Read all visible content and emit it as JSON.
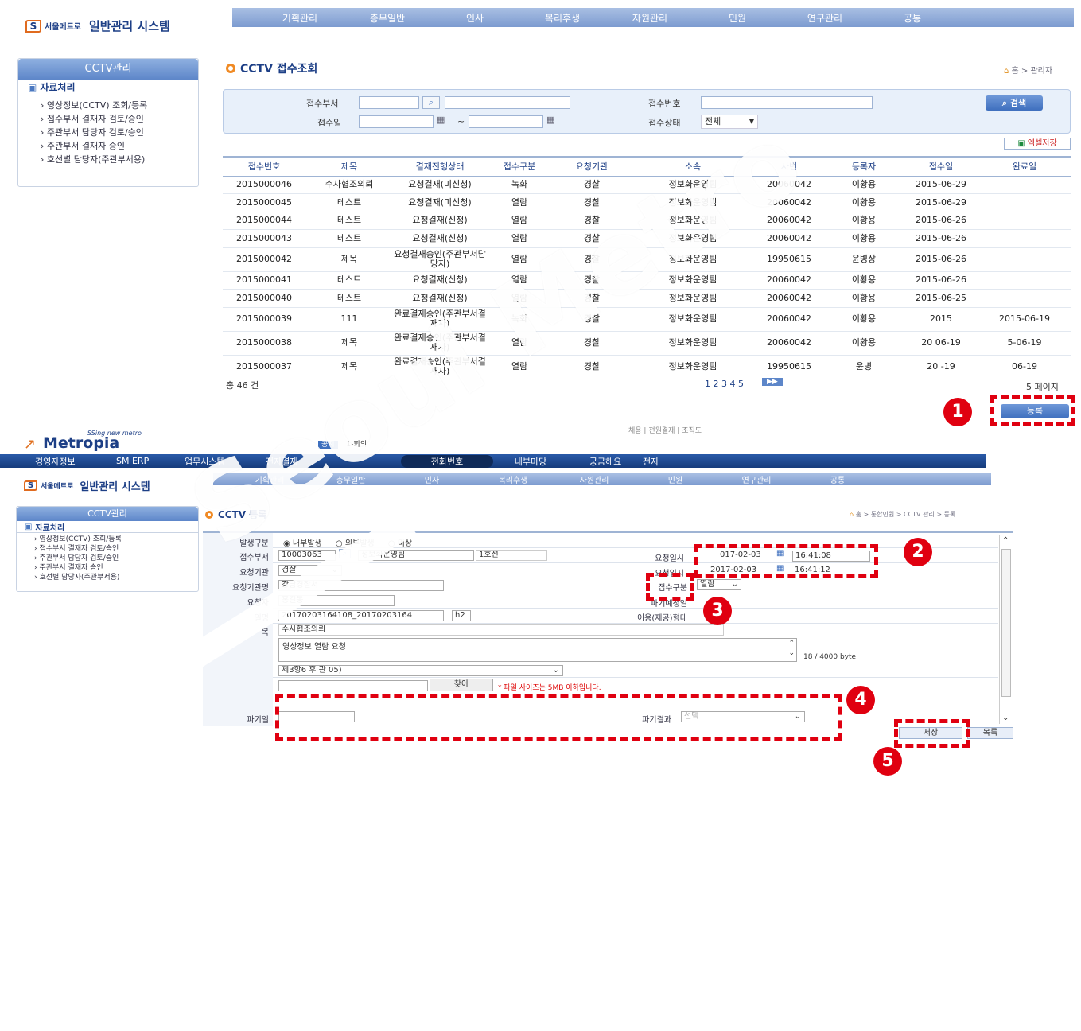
{
  "top": {
    "logo_text": "서울메트로",
    "system_title": "일반관리 시스템",
    "nav": [
      "기획관리",
      "총무일반",
      "인사",
      "복리후생",
      "자원관리",
      "민원",
      "연구관리",
      "공통"
    ]
  },
  "sidebar": {
    "header": "CCTV관리",
    "section": "자료처리",
    "items": [
      "영상정보(CCTV) 조회/등록",
      "접수부서 결재자 검토/승인",
      "주관부서 담당자 검토/승인",
      "주관부서 결재자 승인",
      "호선별 담당자(주관부서용)"
    ]
  },
  "page": {
    "title": "CCTV 접수조회",
    "breadcrumb": "홈 > 관리자"
  },
  "search": {
    "dept_label": "접수부서",
    "date_label": "접수일",
    "tilde": "~",
    "no_label": "접수번호",
    "status_label": "접수상태",
    "status_value": "전체",
    "search_button": "검색",
    "excel_button": "엑셀저장"
  },
  "table": {
    "headers": [
      "접수번호",
      "제목",
      "결재진행상태",
      "접수구분",
      "요청기관",
      "소속",
      "사번",
      "등록자",
      "접수일",
      "완료일"
    ],
    "rows": [
      [
        "2015000046",
        "수사협조의뢰",
        "요청결재(미신청)",
        "녹화",
        "경찰",
        "정보화운영팀",
        "20060042",
        "이황용",
        "2015-06-29",
        ""
      ],
      [
        "2015000045",
        "테스트",
        "요청결재(미신청)",
        "열람",
        "경찰",
        "정보화운영팀",
        "20060042",
        "이황용",
        "2015-06-29",
        ""
      ],
      [
        "2015000044",
        "테스트",
        "요청결재(신청)",
        "열람",
        "경찰",
        "정보화운영팀",
        "20060042",
        "이황용",
        "2015-06-26",
        ""
      ],
      [
        "2015000043",
        "테스트",
        "요청결재(신청)",
        "열람",
        "경찰",
        "정보화운영팀",
        "20060042",
        "이황용",
        "2015-06-26",
        ""
      ],
      [
        "2015000042",
        "제목",
        "요청결재승인(주관부서담당자)",
        "열람",
        "경찰",
        "정보화운영팀",
        "19950615",
        "윤병상",
        "2015-06-26",
        ""
      ],
      [
        "2015000041",
        "테스트",
        "요청결재(신청)",
        "열람",
        "경찰",
        "정보화운영팀",
        "20060042",
        "이황용",
        "2015-06-26",
        ""
      ],
      [
        "2015000040",
        "테스트",
        "요청결재(신청)",
        "열람",
        "경찰",
        "정보화운영팀",
        "20060042",
        "이황용",
        "2015-06-25",
        ""
      ],
      [
        "2015000039",
        "111",
        "완료결재승인(주관부서결재자)",
        "녹화",
        "경찰",
        "정보화운영팀",
        "20060042",
        "이황용",
        "2015",
        "2015-06-19"
      ],
      [
        "2015000038",
        "제목",
        "완료결재승인(주관부서결재자)",
        "열람",
        "경찰",
        "정보화운영팀",
        "20060042",
        "이황용",
        "20  06-19",
        "  5-06-19"
      ],
      [
        "2015000037",
        "제목",
        "완료결재승인(주관부서결재자)",
        "열람",
        "경찰",
        "정보화운영팀",
        "19950615",
        "윤병",
        "20  -19",
        "  06-19"
      ]
    ],
    "total": "총 46 건",
    "pages": "1 2 3 4 5",
    "page_count": "5 페이지",
    "register_button": "등록"
  },
  "portal": {
    "slogan": "SSing new metro",
    "brand": "Metropia",
    "notice_tag": "공지",
    "notice_text": "1-회의",
    "toplinks": "채용 | 전원결재 | 조직도",
    "nav": [
      "경영자정보",
      "SM ERP",
      "업무시스템",
      "전자결재",
      "전화번호",
      "내부마당",
      "궁금해요",
      "전자"
    ]
  },
  "form": {
    "title": "CCTV 등록",
    "breadcrumb": "홈 > 통합민원 > CCTV 관리 > 등록",
    "labels": {
      "type": "발생구분",
      "dept": "접수부서",
      "agency": "요청기관",
      "agency_name": "요청기관명",
      "requester": "요청자",
      "file": "일명",
      "title": "목",
      "reg_time": "요청일시",
      "req_time": "요청일시",
      "kind": "접수구분",
      "destroy_plan": "파기예정일",
      "usage": "이용(제공)형태",
      "destroy_date": "파기일",
      "destroy_result": "파기결과"
    },
    "radio": [
      "내부발생",
      "외부발생",
      "미상"
    ],
    "dept_code": "10003063",
    "dept_name": "정보화운영팀",
    "line": "1호선",
    "agency_value": "경찰",
    "agency_name_value": "강남경찰서",
    "requester_value": "홍길동",
    "file_value": "20170203164108_20170203164",
    "file_ext": "h2",
    "title_value": "수사협조의뢰",
    "content_value": "영상정보 열람 요청",
    "byte_count": "18 / 4000 byte",
    "law_value": "제3항6  후 관   05)",
    "find_button": "찾아",
    "file_note": "* 파일 사이즈는 5MB 이하입니다.",
    "reg_date": "017-02-03",
    "reg_clock": "16:41:08",
    "req_date": "2017-02-03",
    "req_clock": "16:41:12",
    "kind_value": "열람",
    "result_value": "선택",
    "save_button": "저장",
    "list_button": "목록"
  },
  "annotations": [
    "1",
    "2",
    "3",
    "4",
    "5"
  ],
  "watermark": "Seoul Metro",
  "colors": {
    "accent": "#1d3f86",
    "highlight": "#e00010",
    "nav": "#7c9bd0"
  }
}
